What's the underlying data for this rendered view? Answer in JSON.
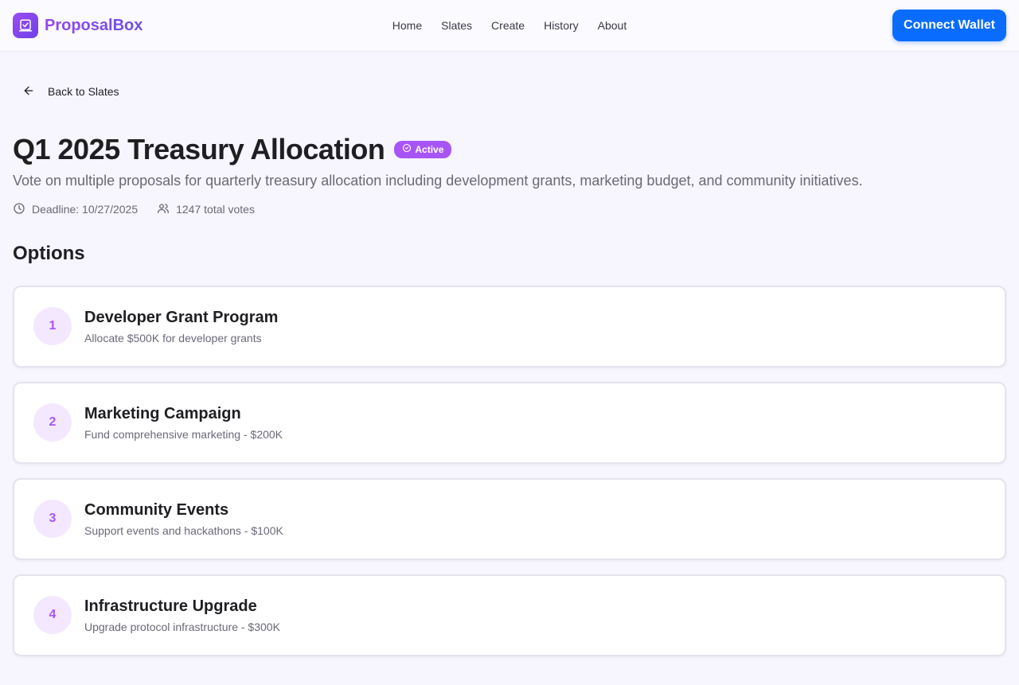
{
  "header": {
    "brand": "ProposalBox",
    "nav": [
      "Home",
      "Slates",
      "Create",
      "History",
      "About"
    ],
    "wallet_button": "Connect Wallet"
  },
  "back_link": "Back to Slates",
  "slate": {
    "title": "Q1 2025 Treasury Allocation",
    "status": "Active",
    "description": "Vote on multiple proposals for quarterly treasury allocation including development grants, marketing budget, and community initiatives.",
    "deadline": "Deadline: 10/27/2025",
    "votes": "1247 total votes"
  },
  "options_heading": "Options",
  "options": [
    {
      "number": "1",
      "title": "Developer Grant Program",
      "description": "Allocate $500K for developer grants"
    },
    {
      "number": "2",
      "title": "Marketing Campaign",
      "description": "Fund comprehensive marketing - $200K"
    },
    {
      "number": "3",
      "title": "Community Events",
      "description": "Support events and hackathons - $100K"
    },
    {
      "number": "4",
      "title": "Infrastructure Upgrade",
      "description": "Upgrade protocol infrastructure - $300K"
    }
  ],
  "colors": {
    "accent": "#a855f7",
    "primary_button": "#0a6cff",
    "background": "#f7f5fd"
  },
  "icons": [
    "ballot-box-icon",
    "arrow-left-icon",
    "check-circle-icon",
    "clock-icon",
    "users-icon"
  ]
}
